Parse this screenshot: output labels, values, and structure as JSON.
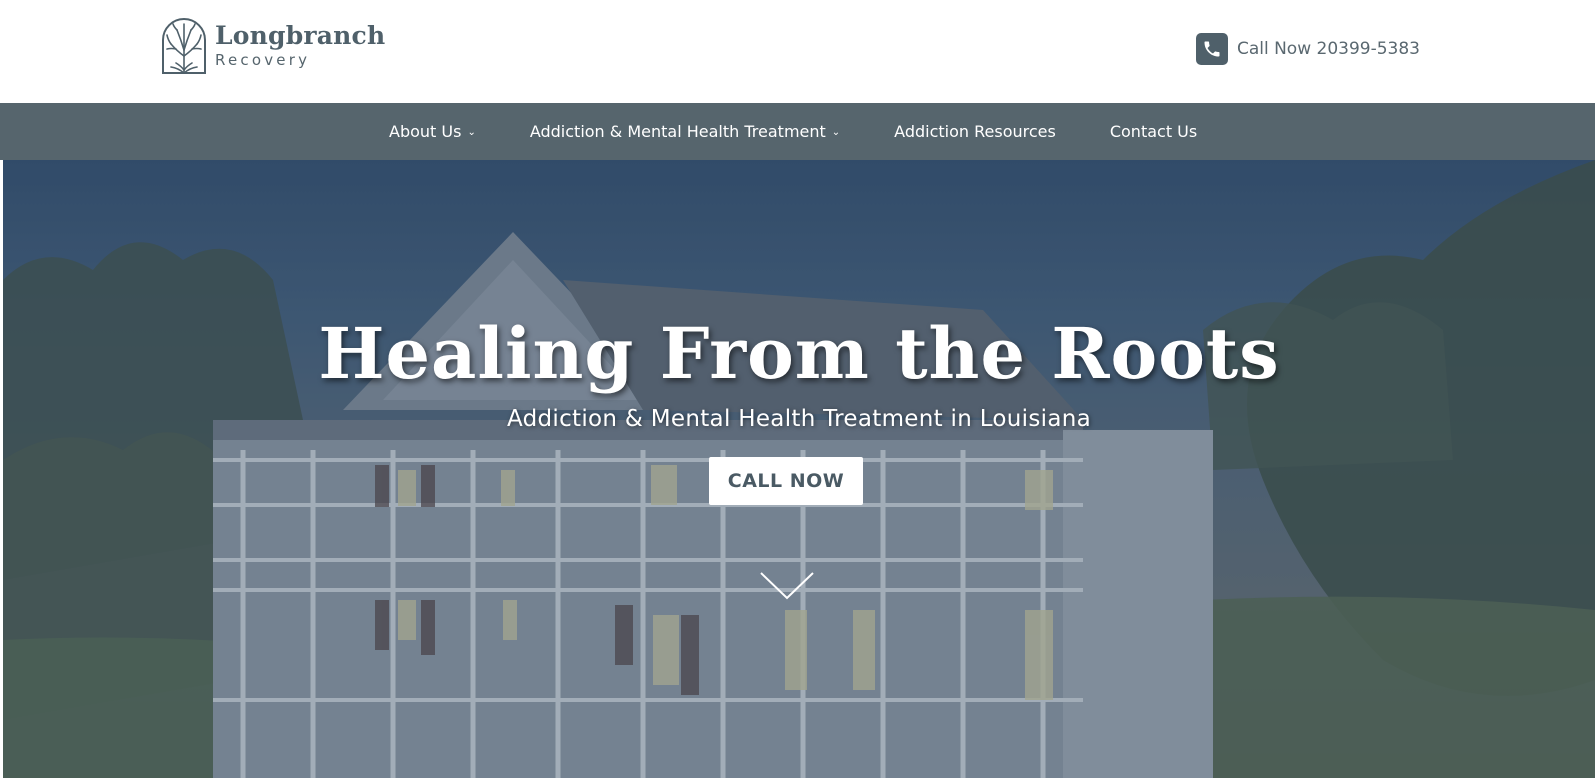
{
  "header": {
    "logo": {
      "name": "Longbranch",
      "sub": "Recovery"
    },
    "call": {
      "label": "Call Now 20399-5383",
      "icon": "phone-icon"
    }
  },
  "nav": {
    "items": [
      {
        "label": "About Us",
        "dropdown": true
      },
      {
        "label": "Addiction & Mental Health Treatment",
        "dropdown": true
      },
      {
        "label": "Addiction Resources",
        "dropdown": false
      },
      {
        "label": "Contact Us",
        "dropdown": false
      }
    ],
    "chevron": "⌄"
  },
  "hero": {
    "title": "Healing From the Roots",
    "subtitle": "Addiction & Mental Health Treatment in Louisiana",
    "cta_label": "CALL NOW",
    "scroll_icon": "chevron-down-icon"
  },
  "colors": {
    "brand": "#56656d",
    "brand_dark": "#4f606a",
    "white": "#ffffff"
  }
}
